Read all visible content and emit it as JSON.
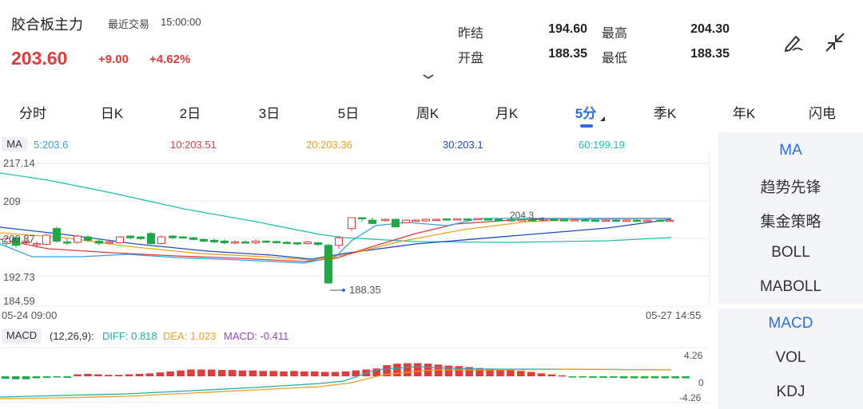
{
  "header": {
    "stock_name": "胶合板主力",
    "trade_label": "最近交易",
    "trade_time": "15:00:00",
    "price": "203.60",
    "change": "+9.00",
    "change_pct": "+4.62%"
  },
  "stats": {
    "prev_close_label": "昨结",
    "prev_close": "194.60",
    "high_label": "最高",
    "high": "204.30",
    "open_label": "开盘",
    "open": "188.35",
    "low_label": "最低",
    "low": "188.35"
  },
  "tabs": [
    {
      "label": "分时"
    },
    {
      "label": "日K"
    },
    {
      "label": "2日"
    },
    {
      "label": "3日"
    },
    {
      "label": "5日"
    },
    {
      "label": "周K"
    },
    {
      "label": "月K"
    },
    {
      "label": "5分",
      "active": true
    },
    {
      "label": "季K"
    },
    {
      "label": "年K"
    },
    {
      "label": "闪电"
    }
  ],
  "ma_legend": {
    "badge": "MA",
    "ma5": "5:203.6",
    "ma10": "10:203.51",
    "ma20": "20:203.36",
    "ma30": "30:203.1",
    "ma60": "60:199.19"
  },
  "price_axis": {
    "top": "217.14",
    "upper": "209",
    "mid": "200.87",
    "lower": "192.73",
    "bottom": "184.59"
  },
  "time_axis": {
    "start": "05-24 09:00",
    "end": "05-27 14:55"
  },
  "annotations": {
    "high_marker": "204.3",
    "low_marker": "188.35"
  },
  "macd_legend": {
    "badge": "MACD",
    "params": "(12,26,9):",
    "diff": "DIFF: 0.818",
    "dea": "DEA: 1.023",
    "macd": "MACD: -0.411"
  },
  "macd_axis": {
    "top": "4.26",
    "mid": "0",
    "bottom": "-4.26"
  },
  "side_panel": {
    "main_indicators": [
      "MA",
      "趋势先锋",
      "集金策略",
      "BOLL",
      "MABOLL"
    ],
    "sub_indicators": [
      "MACD",
      "VOL",
      "KDJ"
    ]
  },
  "colors": {
    "up": "#e23b3b",
    "down": "#1fa845",
    "accent": "#2b6ee6",
    "ma5": "#3aa0e0",
    "ma10": "#e23b3b",
    "ma20": "#f0a020",
    "ma30": "#1a4fc0",
    "ma60": "#20c0b0"
  },
  "icons": {
    "edit": "pen-draw-icon",
    "collapse": "collapse-arrows-icon",
    "expand": "chevron-down-icon"
  }
}
